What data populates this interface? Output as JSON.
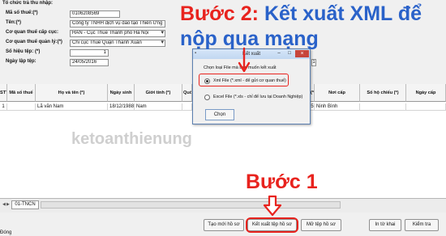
{
  "form": {
    "org_label": "Tổ chức trả thu nhập:",
    "tax_code_label": "Mã số thuế:(*)",
    "tax_code_value": "0106208569",
    "name_label": "Tên:(*)",
    "name_value": "Công ty TNHH dịch vụ đào tạo Thiên Ưng",
    "tax_agency_label": "Cơ quan thuế cấp cục:",
    "tax_agency_value": "HAN - Cục Thuế Thành phố Hà Nội",
    "managing_agency_label": "Cơ quan thuế quản lý:(*)",
    "managing_agency_value": "Chi cục Thuế Quận Thanh Xuân",
    "serial_label": "Số hiệu tệp: (*)",
    "serial_value": "1",
    "date_label": "Ngày lập tệp:",
    "date_value": "24/05/2016",
    "right_field_value": "1"
  },
  "table": {
    "columns": [
      "STT",
      "Mã số thuế",
      "Họ và tên (*)",
      "Ngày sinh",
      "Giới tính (*)",
      "Quố",
      "(*)",
      "Nơi cấp",
      "Số hộ chiếu (*)",
      "Ngày cấp"
    ],
    "rows": [
      {
        "stt": "1",
        "tax_code": "",
        "name": "Lã văn Nam",
        "dob": "18/12/1988",
        "gender": "Nam",
        "qual": "",
        "col7": "5",
        "place": "Ninh Bình",
        "passport": "",
        "issued": ""
      }
    ]
  },
  "sheet_tab": "01-TNCN",
  "buttons": {
    "create": "Tạo mới hồ sơ",
    "export": "Kết xuất tệp hồ sơ",
    "open": "Mở tệp hồ sơ",
    "print": "In tờ khai",
    "check": "Kiểm tra",
    "close": "Đóng"
  },
  "dialog": {
    "title": "Kết xuất",
    "prompt": "Chọn loại File mà bạn muốn kết xuất",
    "option_xml": "Xml File (*.xml - để gửi cơ quan thuế)",
    "option_excel": "Excel File (*.xls - chỉ để lưu tại Doanh Nghiệp)",
    "choose_button": "Chọn",
    "selected": "xml"
  },
  "overlay": {
    "step2_label": "Bước 2:",
    "step2_text": "Kết xuất XML để",
    "step2_text_line2": "nộp qua mạng",
    "watermark": "ketoanthienung",
    "step1_label": "Bước 1"
  },
  "colors": {
    "annotation_red": "#e8231e",
    "step2_blue": "#2a62c9",
    "watermark_gray": "#cfcfcf"
  }
}
